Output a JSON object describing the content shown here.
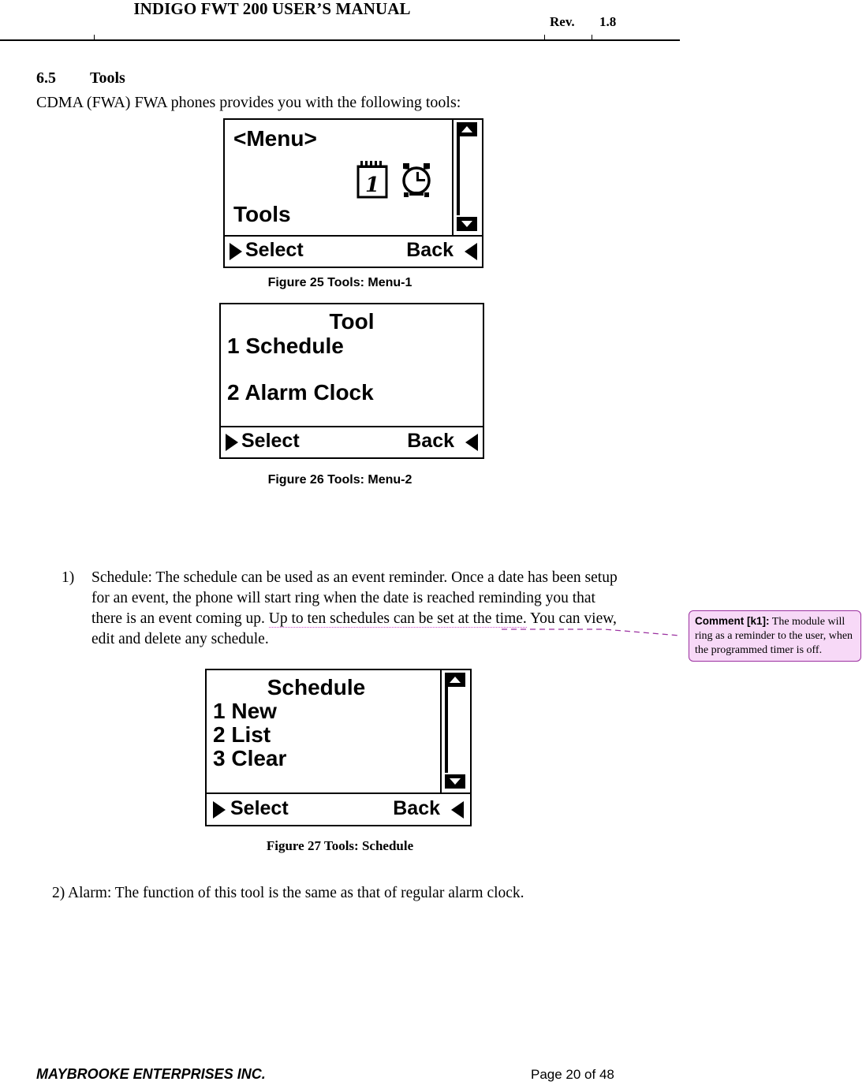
{
  "header": {
    "title": "INDIGO FWT 200 USER’S MANUAL",
    "rev_label": "Rev.",
    "rev_value": "1.8"
  },
  "section": {
    "number": "6.5",
    "title": "Tools",
    "intro": "CDMA (FWA) FWA phones provides you with the following tools:"
  },
  "figures": [
    {
      "id": "figure-25",
      "caption": "Figure 25  Tools: Menu-1",
      "screen": {
        "title": "<Menu>",
        "selected_label": "Tools",
        "icons": [
          "calendar-icon",
          "alarm-clock-icon"
        ],
        "softkey_left": "Select",
        "softkey_right": "Back",
        "scrollbar": true
      }
    },
    {
      "id": "figure-26",
      "caption": "Figure 26  Tools: Menu-2",
      "screen": {
        "title": "Tool",
        "items": [
          "1 Schedule",
          "2 Alarm Clock"
        ],
        "softkey_left": "Select",
        "softkey_right": "Back",
        "scrollbar": false
      }
    },
    {
      "id": "figure-27",
      "caption": "Figure 27  Tools: Schedule",
      "screen": {
        "title": "Schedule",
        "items": [
          "1 New",
          "2 List",
          "3 Clear"
        ],
        "softkey_left": "Select",
        "softkey_right": "Back",
        "scrollbar": true
      }
    }
  ],
  "body": {
    "item1_marker": "1)",
    "item1_text_before": "Schedule: The schedule can be used as an event reminder. Once a date has been setup for an event, the phone will start ring when the date is reached reminding you that there is an event coming up. ",
    "item1_text_anchor": "Up to ten schedules can be set at the time.",
    "item1_text_after": " You can view, edit and delete any schedule.",
    "item2_text": "2) Alarm: The function of this tool is the same as that of regular alarm clock."
  },
  "comment": {
    "label": "Comment [k1]:",
    "text": " The module will ring as a reminder to the user, when the programmed timer is off.",
    "border_color": "#9b30a0",
    "background_color": "#f7d9f7"
  },
  "footer": {
    "company": "MAYBROOKE ENTERPRISES INC.",
    "page": "Page 20 of 48"
  }
}
